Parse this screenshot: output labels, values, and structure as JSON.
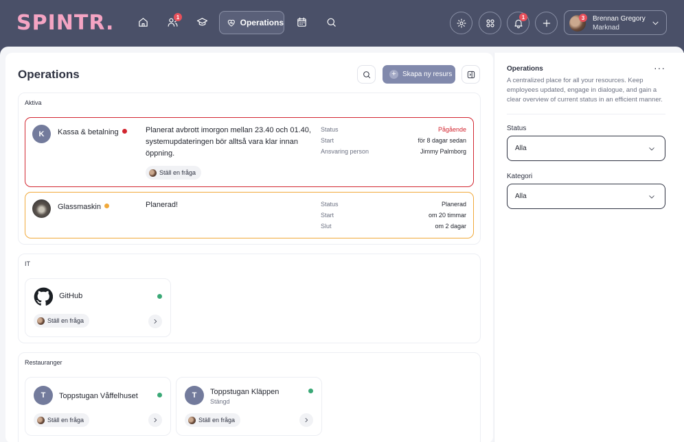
{
  "brand": {
    "logo_text": "SPINTR."
  },
  "nav": {
    "items": [
      {
        "name": "home",
        "icon": "home-icon"
      },
      {
        "name": "people",
        "icon": "people-icon",
        "badge": "1"
      },
      {
        "name": "learning",
        "icon": "graduation-cap-icon"
      },
      {
        "name": "operations",
        "icon": "heart-pulse-icon",
        "label": "Operations",
        "active": true
      },
      {
        "name": "calendar",
        "icon": "calendar-icon"
      },
      {
        "name": "search",
        "icon": "search-icon"
      }
    ],
    "actions": [
      {
        "name": "settings",
        "icon": "gear-icon"
      },
      {
        "name": "apps",
        "icon": "apps-grid-icon"
      },
      {
        "name": "notifications",
        "icon": "bell-icon",
        "badge": "1"
      },
      {
        "name": "create",
        "icon": "plus-icon"
      }
    ],
    "user": {
      "name": "Brennan Gregory",
      "department": "Marknad",
      "badge": "3"
    }
  },
  "main": {
    "title": "Operations",
    "create_button": "Skapa ny resurs",
    "sections": {
      "active": {
        "title": "Aktiva",
        "cards": [
          {
            "avatar": "K",
            "name": "Kassa & betalning",
            "status_color": "#d2252f",
            "message": "Planerat avbrott imorgon mellan 23.40 och 01.40, systemupdateringen bör alltså vara klar innan öppning.",
            "ask": "Ställ en fråga",
            "meta": [
              {
                "label": "Status",
                "value": "Pågående"
              },
              {
                "label": "Start",
                "value": "för 8 dagar sedan"
              },
              {
                "label": "Ansvaring person",
                "value": "Jimmy Palmborg"
              }
            ]
          },
          {
            "name": "Glassmaskin",
            "status_color": "#f1a93a",
            "message": "Planerad!",
            "meta": [
              {
                "label": "Status",
                "value": "Planerad"
              },
              {
                "label": "Start",
                "value": "om 20 timmar"
              },
              {
                "label": "Slut",
                "value": "om 2 dagar"
              }
            ]
          }
        ]
      },
      "it": {
        "title": "IT",
        "resources": [
          {
            "name": "GitHub",
            "icon": "github-icon",
            "status_color": "#3aa876",
            "ask": "Ställ en fråga"
          }
        ]
      },
      "restaurants": {
        "title": "Restauranger",
        "resources": [
          {
            "avatar": "T",
            "name": "Toppstugan Våffelhuset",
            "status_color": "#3aa876",
            "ask": "Ställ en fråga"
          },
          {
            "avatar": "T",
            "name": "Toppstugan Kläppen",
            "subtitle": "Stängd",
            "status_color": "#3aa876",
            "ask": "Ställ en fråga"
          }
        ]
      }
    }
  },
  "side": {
    "title": "Operations",
    "more": "···",
    "description": "A centralized place for all your resources. Keep employees updated, engage in dialogue, and gain a clear overview of current status in an efficient manner.",
    "filters": [
      {
        "label": "Status",
        "value": "Alla"
      },
      {
        "label": "Kategori",
        "value": "Alla"
      }
    ]
  }
}
